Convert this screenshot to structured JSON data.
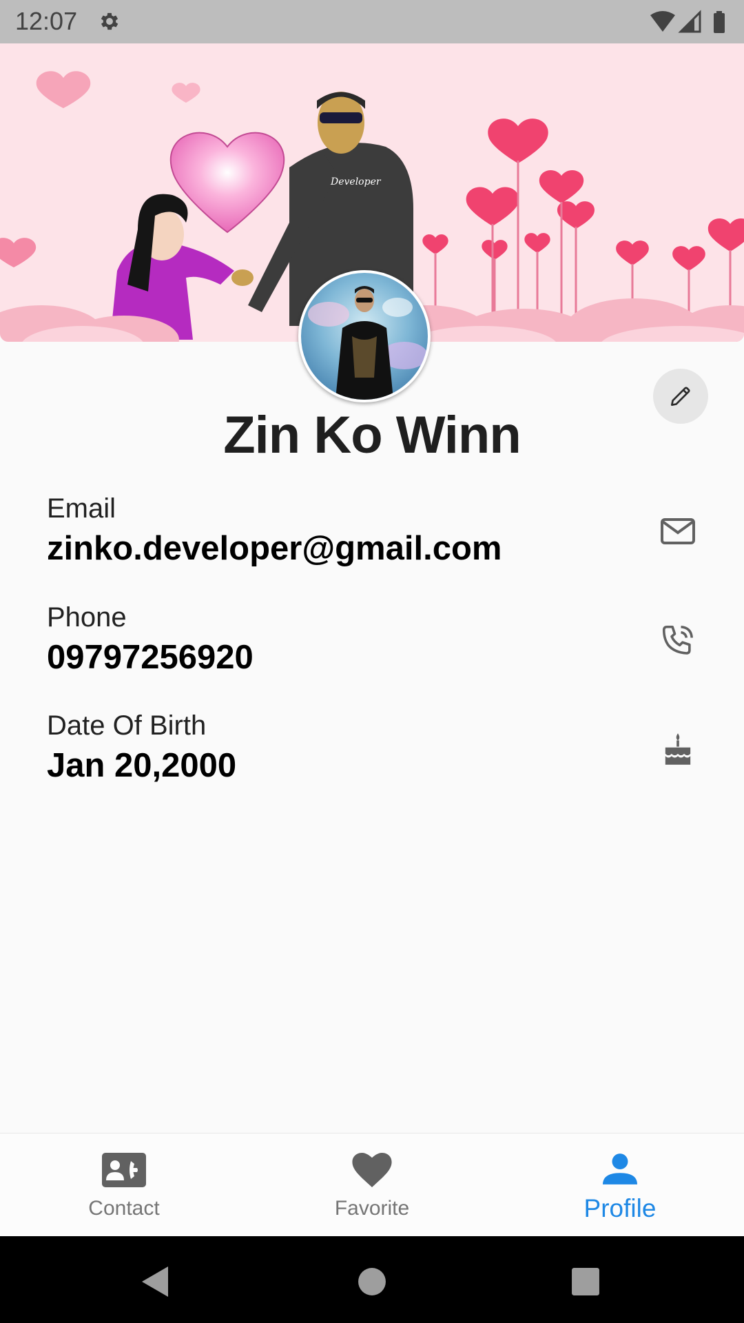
{
  "status_bar": {
    "time": "12:07"
  },
  "profile": {
    "name": "Zin Ko Winn"
  },
  "fields": [
    {
      "label": "Email",
      "value": "zinko.developer@gmail.com",
      "icon": "mail-icon"
    },
    {
      "label": "Phone",
      "value": "09797256920",
      "icon": "phone-icon"
    },
    {
      "label": "Date Of Birth",
      "value": "Jan 20,2000",
      "icon": "cake-icon"
    }
  ],
  "bottom_nav": {
    "items": [
      {
        "label": "Contact",
        "icon": "contact-card-icon",
        "active": false
      },
      {
        "label": "Favorite",
        "icon": "heart-icon",
        "active": false
      },
      {
        "label": "Profile",
        "icon": "person-icon",
        "active": true
      }
    ]
  },
  "colors": {
    "accent": "#1e88e5",
    "inactive": "#757575",
    "status_bar": "#bdbdbd",
    "cover_bg": "#fde3e8"
  },
  "icons": {
    "status_left": "settings-gear-icon",
    "status_right": [
      "wifi-icon",
      "signal-icon",
      "battery-icon"
    ],
    "edit": "pencil-icon",
    "system_nav": [
      "back-icon",
      "home-icon",
      "recents-icon"
    ]
  }
}
